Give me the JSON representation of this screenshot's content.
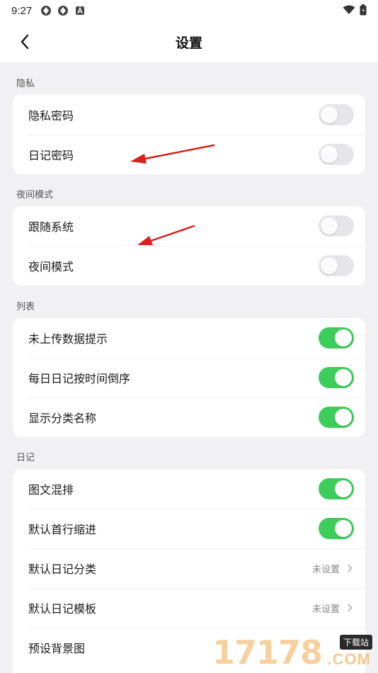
{
  "status_bar": {
    "time": "9:27"
  },
  "header": {
    "title": "设置"
  },
  "sections": [
    {
      "label": "隐私",
      "rows": [
        {
          "label": "隐私密码",
          "toggle": false
        },
        {
          "label": "日记密码",
          "toggle": false
        }
      ]
    },
    {
      "label": "夜间模式",
      "rows": [
        {
          "label": "跟随系统",
          "toggle": false
        },
        {
          "label": "夜间模式",
          "toggle": false
        }
      ]
    },
    {
      "label": "列表",
      "rows": [
        {
          "label": "未上传数据提示",
          "toggle": true
        },
        {
          "label": "每日日记按时间倒序",
          "toggle": true
        },
        {
          "label": "显示分类名称",
          "toggle": true
        }
      ]
    },
    {
      "label": "日记",
      "rows": [
        {
          "label": "图文混排",
          "toggle": true
        },
        {
          "label": "默认首行缩进",
          "toggle": true
        },
        {
          "label": "默认日记分类",
          "value": "未设置"
        },
        {
          "label": "默认日记模板",
          "value": "未设置"
        },
        {
          "label": "预设背景图"
        }
      ]
    }
  ],
  "watermark": {
    "number": "17178",
    "badge": "下载站",
    "suffix": ".COM"
  },
  "colors": {
    "toggle_on": "#3dcd5a",
    "toggle_off": "#e6e6ea",
    "annotation_arrow": "#d9201c"
  }
}
